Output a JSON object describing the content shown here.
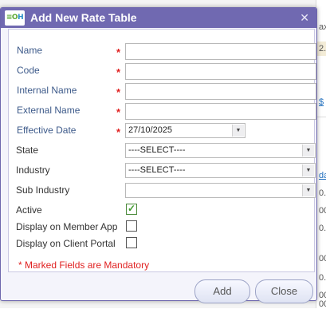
{
  "dialog": {
    "title": "Add New Rate Table",
    "logo_part1": "≡O",
    "logo_part2": "H",
    "close_icon_glyph": "✕"
  },
  "form": {
    "name": {
      "label": "Name",
      "required_mark": "*",
      "value": ""
    },
    "code": {
      "label": "Code",
      "required_mark": "*",
      "value": ""
    },
    "internal_name": {
      "label": "Internal Name",
      "required_mark": "*",
      "value": ""
    },
    "external_name": {
      "label": "External Name",
      "required_mark": "*",
      "value": ""
    },
    "effective_date": {
      "label": "Effective Date",
      "required_mark": "*",
      "value": "27/10/2025"
    },
    "state": {
      "label": "State",
      "value": "----SELECT----"
    },
    "industry": {
      "label": "Industry",
      "value": "----SELECT----"
    },
    "sub_industry": {
      "label": "Sub Industry",
      "value": ""
    },
    "active": {
      "label": "Active",
      "checked": true
    },
    "display_on_member_app": {
      "label": "Display on Member App",
      "checked": false
    },
    "display_on_client_portal": {
      "label": "Display on Client Portal",
      "checked": false
    },
    "mandatory_note": "* Marked Fields are Mandatory"
  },
  "buttons": {
    "add": "Add",
    "close": "Close"
  },
  "background_fragments": [
    "ax",
    "2.",
    "$",
    "da",
    "0.",
    "00",
    "0.",
    "00",
    "0.",
    "00",
    "00"
  ],
  "colors": {
    "titlebar": "#7069b1",
    "required": "#e02020",
    "label_blue": "#3d5a8a",
    "checkbox_tick": "#3c9a2a"
  },
  "icons": {
    "close": "close-icon",
    "dropdown": "chevron-down-icon",
    "checkmark": "checkmark-icon",
    "logo": "app-logo"
  }
}
